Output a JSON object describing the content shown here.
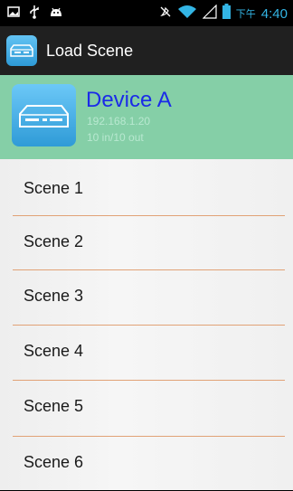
{
  "status_bar": {
    "time": "4:40",
    "time_prefix": "下午",
    "icons": [
      "image-icon",
      "usb-icon",
      "android-debug-icon",
      "mute-icon",
      "wifi-icon",
      "signal-icon",
      "battery-icon"
    ]
  },
  "action_bar": {
    "title": "Load Scene",
    "icon": "device-app-icon"
  },
  "device": {
    "name": "Device A",
    "ip": "192.168.1.20",
    "io": "10 in/10 out",
    "icon": "matrix-device-icon"
  },
  "scenes": [
    {
      "label": "Scene 1"
    },
    {
      "label": "Scene 2"
    },
    {
      "label": "Scene 3"
    },
    {
      "label": "Scene 4"
    },
    {
      "label": "Scene 5"
    },
    {
      "label": "Scene 6"
    }
  ],
  "colors": {
    "header_bg": "#85cfa7",
    "device_name": "#1b2be8",
    "divider": "#e1a276",
    "accent": "#33b5e5"
  }
}
